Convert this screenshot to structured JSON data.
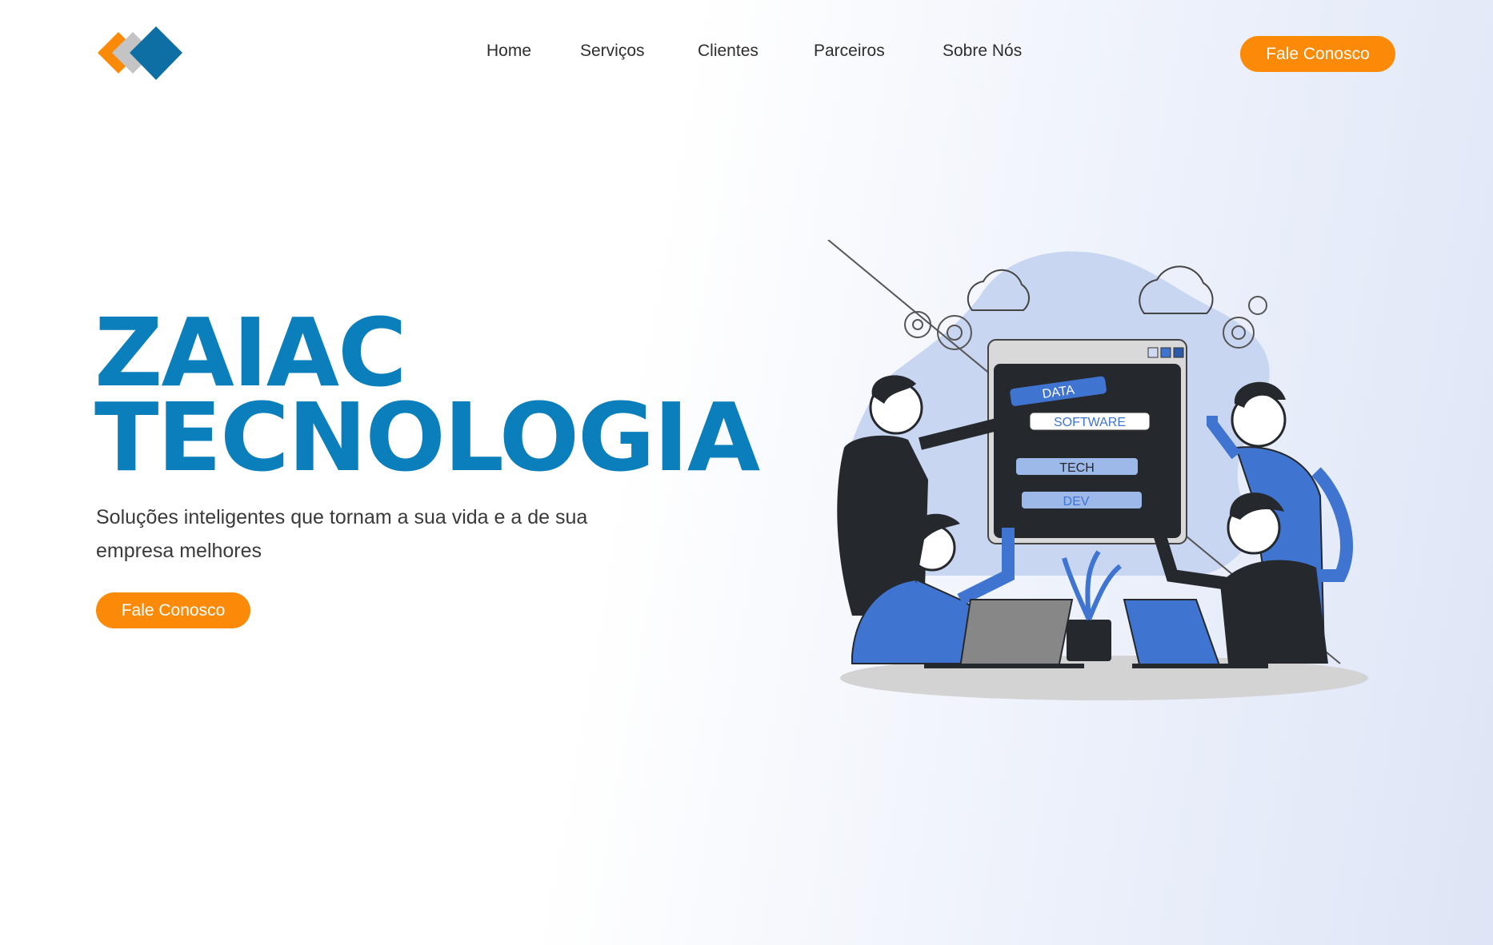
{
  "brand": {
    "logo_icon": "diamond-logo-icon",
    "colors": {
      "orange": "#fb8a08",
      "gray": "#c4c4c4",
      "blue": "#0d6fa3"
    }
  },
  "nav": {
    "items": [
      {
        "label": "Home"
      },
      {
        "label": "Serviços"
      },
      {
        "label": "Clientes"
      },
      {
        "label": "Parceiros"
      },
      {
        "label": "Sobre Nós"
      }
    ],
    "cta_label": "Fale Conosco"
  },
  "hero": {
    "title_line1": "ZAIAC",
    "title_line2": "TECNOLOGIA",
    "subtitle": "Soluções inteligentes que tornam a sua vida e a de sua empresa melhores",
    "cta_label": "Fale Conosco",
    "title_color": "#0a7fbc",
    "accent_color": "#fb8a08"
  },
  "illustration": {
    "panel_labels": [
      "DATA",
      "SOFTWARE",
      "TECH",
      "DEV"
    ],
    "illustration_accent": "#3f74d1"
  }
}
